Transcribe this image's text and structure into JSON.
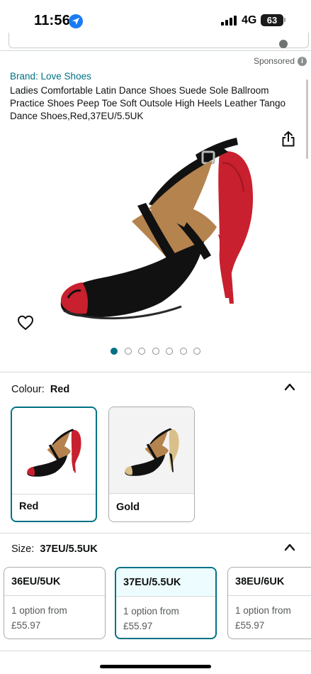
{
  "status_bar": {
    "time": "11:56",
    "network": "4G",
    "battery": "63"
  },
  "sponsored_label": "Sponsored",
  "product": {
    "brand": "Brand: Love Shoes",
    "title": "Ladies Comfortable Latin Dance Shoes Suede Sole Ballroom Practice Shoes Peep Toe Soft Outsole High Heels Leather Tango Dance Shoes,Red,37EU/5.5UK",
    "image_count": 7,
    "active_image_index": 0
  },
  "colour": {
    "label": "Colour:",
    "selected": "Red",
    "options": [
      {
        "name": "Red",
        "selected": true
      },
      {
        "name": "Gold",
        "selected": false
      }
    ]
  },
  "size": {
    "label": "Size:",
    "selected": "37EU/5.5UK",
    "options": [
      {
        "name": "36EU/5UK",
        "availability": "1 option from",
        "price": "£55.97",
        "selected": false
      },
      {
        "name": "37EU/5.5UK",
        "availability": "1 option from",
        "price": "£55.97",
        "selected": true
      },
      {
        "name": "38EU/6UK",
        "availability": "1 option from",
        "price": "£55.97",
        "selected": false
      }
    ]
  },
  "colors": {
    "link": "#007185",
    "accent_red": "#c8202e",
    "text": "#0f1111",
    "muted": "#565959"
  },
  "icons": [
    "location-arrow-icon",
    "signal-icon",
    "battery-icon",
    "info-icon",
    "share-icon",
    "heart-icon",
    "chevron-up-icon"
  ]
}
